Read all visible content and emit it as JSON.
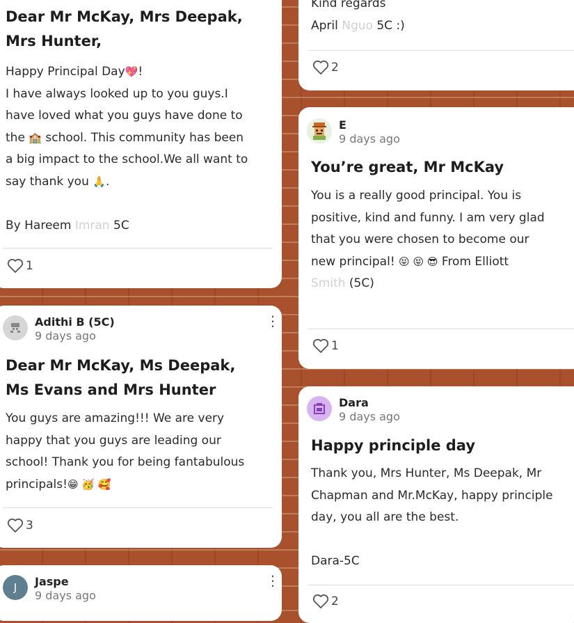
{
  "cards": {
    "c1": {
      "title": "Dear Mr McKay, Mrs Deepak,\nMrs Hunter,",
      "body_a": "Happy Principal Day",
      "body_heart": "💖",
      "body_b": "!\nI have always looked up to you guys.I\nhave loved what you guys have done to\nthe ",
      "body_school": "🏫",
      "body_c": " school. This community has been\na big impact to the school.We all want to\nsay thank you ",
      "body_pray": "🙏",
      "body_d": ".\n\nBy Hareem ",
      "body_blur": "Imran",
      "body_e": " 5C",
      "likes": "1"
    },
    "c2": {
      "author": "Adithi B (5C)",
      "timestamp": "9 days ago",
      "title": "Dear Mr McKay, Ms Deepak,\nMs Evans and Mrs Hunter",
      "body": "You guys are amazing!!! We are very\nhappy that you guys are leading our\nschool! Thank you for being fantabulous\nprincipals!",
      "emojis": "😁 🥳 🥰",
      "likes": "3"
    },
    "c3": {
      "author": "Jaspe",
      "timestamp": "9 days ago",
      "avatar_letter": "J"
    },
    "c4": {
      "body_a": "Kind regards\nApril ",
      "body_blur": "Nguo",
      "body_b": " 5C :)",
      "likes": "2"
    },
    "c5": {
      "author": "E",
      "timestamp": "9 days ago",
      "title": "You’re great, Mr McKay",
      "body": "You is a really good principal. You is\npositive, kind and funny. I am very glad\nthat you were chosen to become our\nnew principal! ",
      "emojis": "😝 😝 😎",
      "body_b": " From Elliott\n",
      "body_blur": "Smith",
      "body_c": " (5C)",
      "likes": "1"
    },
    "c6": {
      "author": "Dara",
      "timestamp": "9 days ago",
      "title": "Happy principle day",
      "body": "Thank you, Mrs Hunter, Ms Deepak, Mr\nChapman and Mr.McKay, happy principle\nday, you all are the best.\n\nDara-5C",
      "likes": "2"
    }
  },
  "colors": {
    "wall": "#a8512c",
    "dara_avatar": "#d7b3f0",
    "jasper_avatar": "#5e7f8f"
  }
}
